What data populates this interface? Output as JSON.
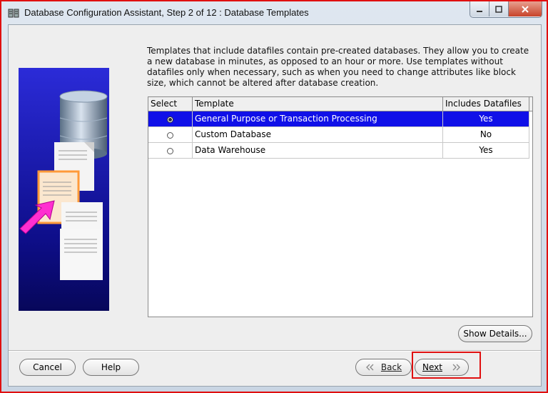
{
  "window": {
    "title": "Database Configuration Assistant, Step 2 of 12 : Database Templates"
  },
  "description": "Templates that include datafiles contain pre-created databases. They allow you to create a new database in minutes, as opposed to an hour or more. Use templates without datafiles only when necessary, such as when you need to change attributes like block size, which cannot be altered after database creation.",
  "table": {
    "headers": [
      "Select",
      "Template",
      "Includes Datafiles"
    ],
    "rows": [
      {
        "template": "General Purpose or Transaction Processing",
        "includes": "Yes",
        "selected": true
      },
      {
        "template": "Custom Database",
        "includes": "No",
        "selected": false
      },
      {
        "template": "Data Warehouse",
        "includes": "Yes",
        "selected": false
      }
    ]
  },
  "buttons": {
    "show_details": "Show Details...",
    "cancel": "Cancel",
    "help": "Help",
    "back": "Back",
    "next": "Next"
  },
  "colors": {
    "selection": "#1010e8",
    "highlight_frame": "#e01010"
  }
}
